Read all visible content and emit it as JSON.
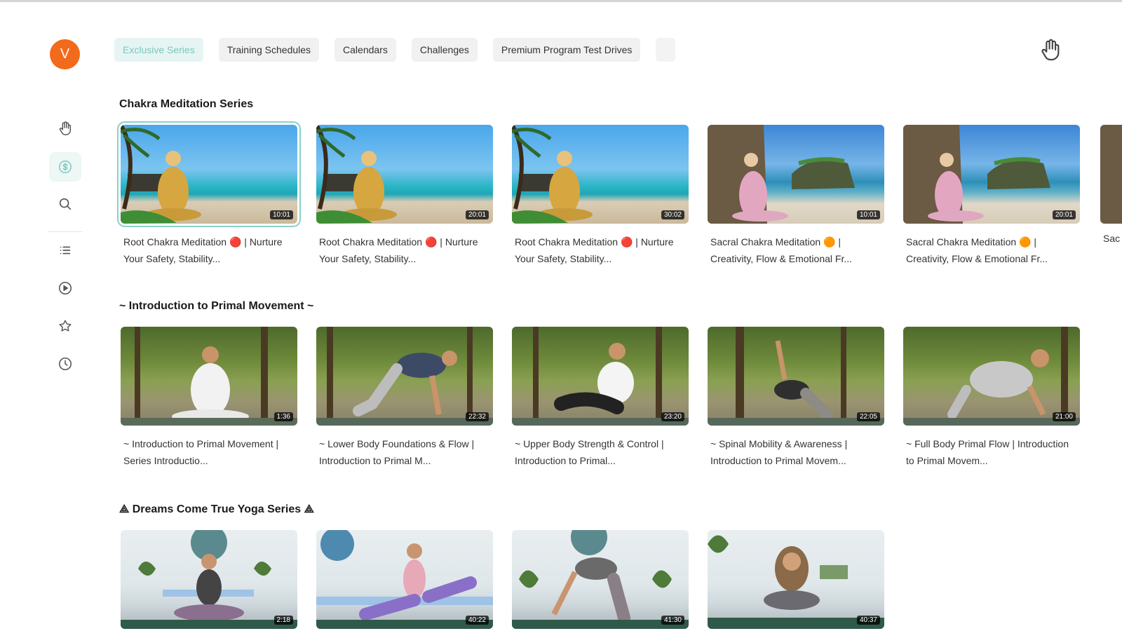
{
  "sidebar": {
    "avatar_letter": "V",
    "items": [
      {
        "icon": "hand-icon"
      },
      {
        "icon": "dollar-coin-icon",
        "active": true
      },
      {
        "icon": "search-icon"
      },
      {
        "icon": "list-icon"
      },
      {
        "icon": "play-circle-icon"
      },
      {
        "icon": "star-icon"
      },
      {
        "icon": "clock-icon"
      }
    ]
  },
  "tabs": [
    {
      "label": "Exclusive Series",
      "active": true
    },
    {
      "label": "Training Schedules"
    },
    {
      "label": "Calendars"
    },
    {
      "label": "Challenges"
    },
    {
      "label": "Premium Program Test Drives"
    }
  ],
  "header": {
    "right_icon": "hand-icon"
  },
  "sections": [
    {
      "title": "Chakra Meditation Series",
      "videos": [
        {
          "title": "Root Chakra Meditation 🔴 | Nurture Your Safety, Stability...",
          "duration": "10:01"
        },
        {
          "title": "Root Chakra Meditation 🔴 | Nurture Your Safety, Stability...",
          "duration": "20:01"
        },
        {
          "title": "Root Chakra Meditation 🔴 | Nurture Your Safety, Stability...",
          "duration": "30:02"
        },
        {
          "title": "Sacral Chakra Meditation 🟠 | Creativity, Flow & Emotional Fr...",
          "duration": "10:01"
        },
        {
          "title": "Sacral Chakra Meditation 🟠 | Creativity, Flow & Emotional Fr...",
          "duration": "20:01"
        }
      ],
      "partial_title": "Sac Cre"
    },
    {
      "title": "~ Introduction to Primal Movement ~",
      "videos": [
        {
          "title": "~ Introduction to Primal Movement | Series Introductio...",
          "duration": "1:36"
        },
        {
          "title": "~ Lower Body Foundations & Flow | Introduction to Primal M...",
          "duration": "22:32"
        },
        {
          "title": "~ Upper Body Strength & Control | Introduction to Primal...",
          "duration": "23:20"
        },
        {
          "title": "~ Spinal Mobility & Awareness | Introduction to Primal Movem...",
          "duration": "22:05"
        },
        {
          "title": "~ Full Body Primal Flow | Introduction to Primal Movem...",
          "duration": "21:00"
        }
      ]
    },
    {
      "title": "⟁ Dreams Come True Yoga Series ⟁",
      "videos": [
        {
          "duration": "2:18"
        },
        {
          "duration": "40:22"
        },
        {
          "duration": "41:30"
        },
        {
          "duration": "40:37"
        }
      ]
    }
  ],
  "colors": {
    "accent": "#79c7be",
    "avatar": "#f26a1b"
  }
}
